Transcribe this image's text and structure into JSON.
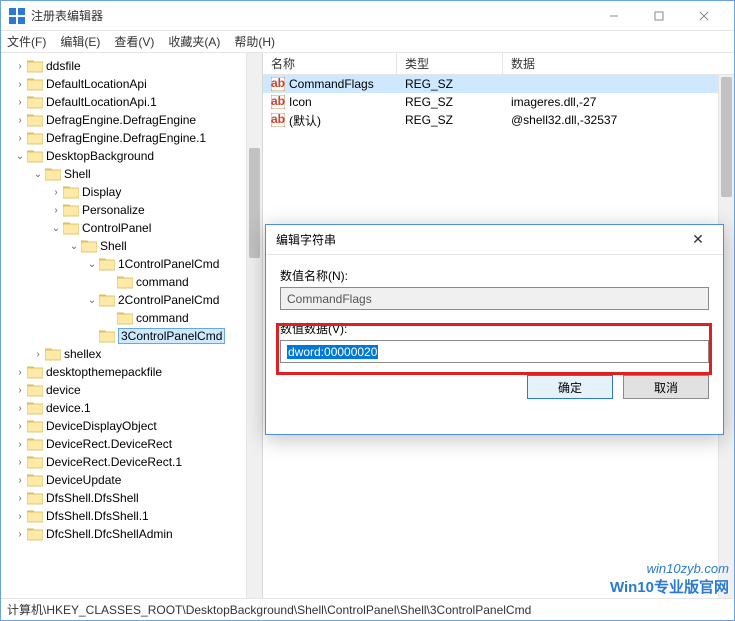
{
  "window": {
    "title": "注册表编辑器"
  },
  "menubar": {
    "file": "文件(F)",
    "edit": "编辑(E)",
    "view": "查看(V)",
    "favorites": "收藏夹(A)",
    "help": "帮助(H)"
  },
  "tree": {
    "items": [
      {
        "depth": 0,
        "arrow": ">",
        "label": "ddsfile"
      },
      {
        "depth": 0,
        "arrow": ">",
        "label": "DefaultLocationApi"
      },
      {
        "depth": 0,
        "arrow": ">",
        "label": "DefaultLocationApi.1"
      },
      {
        "depth": 0,
        "arrow": ">",
        "label": "DefragEngine.DefragEngine"
      },
      {
        "depth": 0,
        "arrow": ">",
        "label": "DefragEngine.DefragEngine.1"
      },
      {
        "depth": 0,
        "arrow": "v",
        "label": "DesktopBackground"
      },
      {
        "depth": 1,
        "arrow": "v",
        "label": "Shell"
      },
      {
        "depth": 2,
        "arrow": ">",
        "label": "Display"
      },
      {
        "depth": 2,
        "arrow": ">",
        "label": "Personalize"
      },
      {
        "depth": 2,
        "arrow": "v",
        "label": "ControlPanel"
      },
      {
        "depth": 3,
        "arrow": "v",
        "label": "Shell"
      },
      {
        "depth": 4,
        "arrow": "v",
        "label": "1ControlPanelCmd"
      },
      {
        "depth": 5,
        "arrow": "",
        "label": "command"
      },
      {
        "depth": 4,
        "arrow": "v",
        "label": "2ControlPanelCmd"
      },
      {
        "depth": 5,
        "arrow": "",
        "label": "command"
      },
      {
        "depth": 4,
        "arrow": "",
        "label": "3ControlPanelCmd",
        "selected": true
      },
      {
        "depth": 1,
        "arrow": ">",
        "label": "shellex"
      },
      {
        "depth": 0,
        "arrow": ">",
        "label": "desktopthemepackfile"
      },
      {
        "depth": 0,
        "arrow": ">",
        "label": "device"
      },
      {
        "depth": 0,
        "arrow": ">",
        "label": "device.1"
      },
      {
        "depth": 0,
        "arrow": ">",
        "label": "DeviceDisplayObject"
      },
      {
        "depth": 0,
        "arrow": ">",
        "label": "DeviceRect.DeviceRect"
      },
      {
        "depth": 0,
        "arrow": ">",
        "label": "DeviceRect.DeviceRect.1"
      },
      {
        "depth": 0,
        "arrow": ">",
        "label": "DeviceUpdate"
      },
      {
        "depth": 0,
        "arrow": ">",
        "label": "DfsShell.DfsShell"
      },
      {
        "depth": 0,
        "arrow": ">",
        "label": "DfsShell.DfsShell.1"
      },
      {
        "depth": 0,
        "arrow": ">",
        "label": "DfcShell.DfcShellAdmin"
      }
    ]
  },
  "list": {
    "headers": {
      "name": "名称",
      "type": "类型",
      "data": "数据"
    },
    "rows": [
      {
        "name": "(默认)",
        "type": "REG_SZ",
        "data": "@shell32.dll,-32537",
        "selected": false
      },
      {
        "name": "Icon",
        "type": "REG_SZ",
        "data": "imageres.dll,-27",
        "selected": false
      },
      {
        "name": "CommandFlags",
        "type": "REG_SZ",
        "data": "",
        "selected": true
      }
    ]
  },
  "dialog": {
    "title": "编辑字符串",
    "name_label": "数值名称(N):",
    "name_value": "CommandFlags",
    "data_label": "数值数据(V):",
    "data_value": "dword:00000020",
    "ok": "确定",
    "cancel": "取消"
  },
  "statusbar": {
    "path": "计算机\\HKEY_CLASSES_ROOT\\DesktopBackground\\Shell\\ControlPanel\\Shell\\3ControlPanelCmd"
  },
  "watermark": {
    "line1": "win10zyb.com",
    "line2": "Win10专业版官网"
  }
}
